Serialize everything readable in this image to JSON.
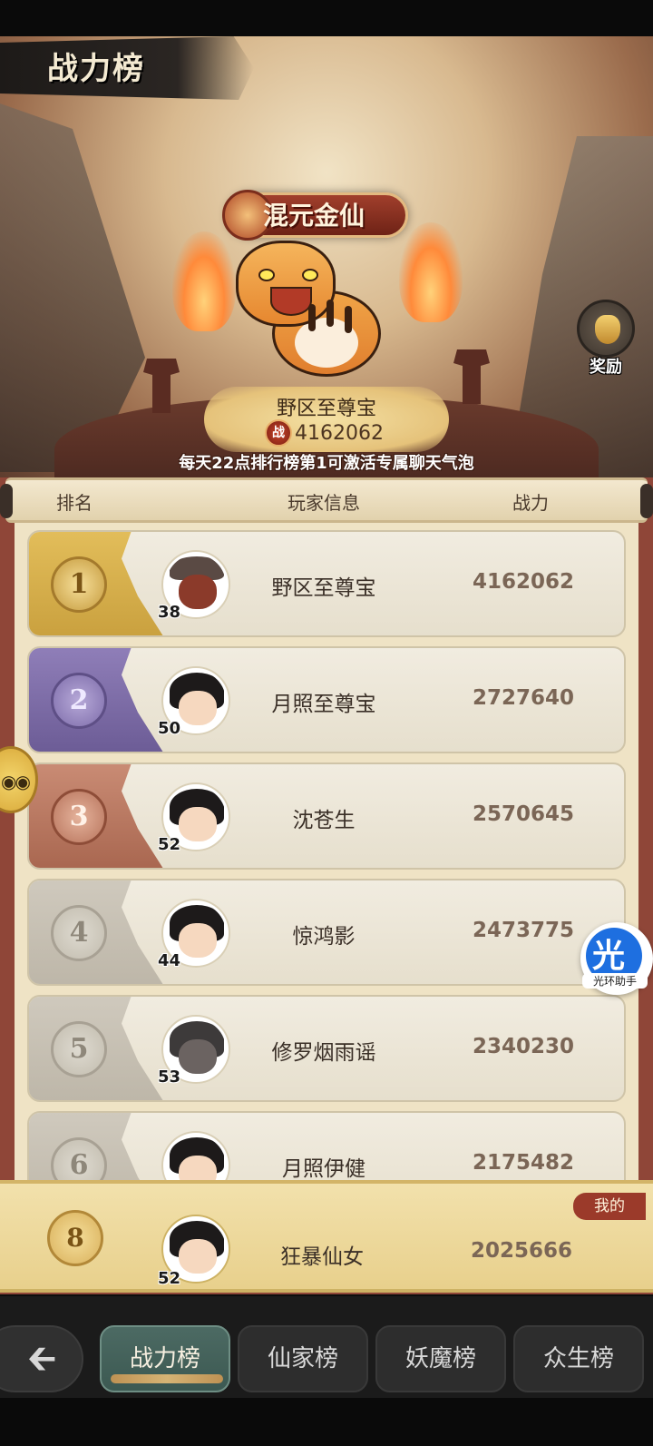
{
  "page_title": "战力榜",
  "champion": {
    "title_badge": "混元金仙",
    "name": "野区至尊宝",
    "power": "4162062",
    "power_icon": "战"
  },
  "reward_button": {
    "label": "奖励",
    "icon": "money-bag-icon"
  },
  "notice": "每天22点排行榜第1可激活专属聊天气泡",
  "table_headers": {
    "rank": "排名",
    "player_info": "玩家信息",
    "power": "战力"
  },
  "rankings": [
    {
      "rank": "1",
      "name": "野区至尊宝",
      "level": "38",
      "power": "4162062"
    },
    {
      "rank": "2",
      "name": "月照至尊宝",
      "level": "50",
      "power": "2727640"
    },
    {
      "rank": "3",
      "name": "沈苍生",
      "level": "52",
      "power": "2570645"
    },
    {
      "rank": "4",
      "name": "惊鸿影",
      "level": "44",
      "power": "2473775"
    },
    {
      "rank": "5",
      "name": "修罗烟雨谣",
      "level": "53",
      "power": "2340230"
    },
    {
      "rank": "6",
      "name": "月照伊健",
      "level": "",
      "power": "2175482"
    }
  ],
  "my_entry": {
    "tag": "我的",
    "rank": "8",
    "name": "狂暴仙女",
    "level": "52",
    "power": "2025666"
  },
  "tabs": [
    {
      "label": "战力榜",
      "active": true
    },
    {
      "label": "仙家榜",
      "active": false
    },
    {
      "label": "妖魔榜",
      "active": false
    },
    {
      "label": "众生榜",
      "active": false
    }
  ],
  "floating_helper": {
    "glyph": "光",
    "caption": "光环助手"
  },
  "colors": {
    "rank1": "#e2bd5a",
    "rank2": "#8f7eb8",
    "rank3": "#c98b74",
    "rank_default": "#cfc9bd",
    "board_bg": "#8f4638",
    "active_tab": "#4c6a63"
  }
}
